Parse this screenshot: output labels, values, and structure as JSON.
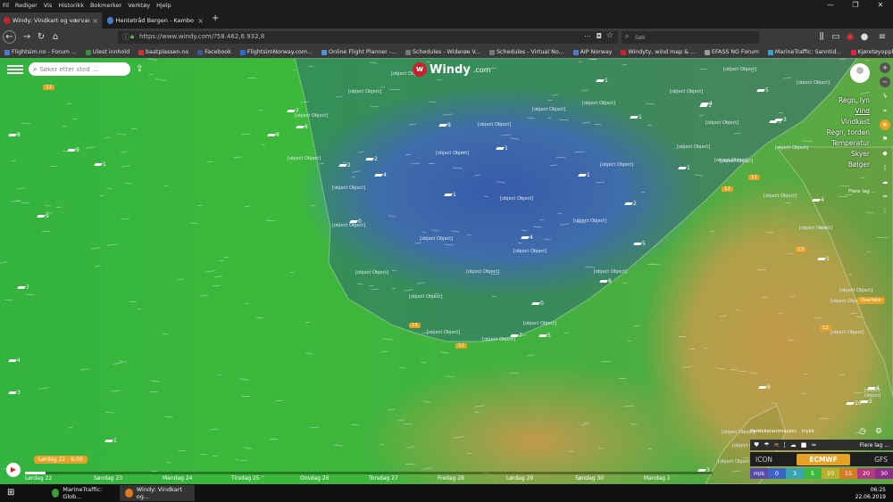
{
  "menu": [
    "Fil",
    "Rediger",
    "Vis",
    "Historikk",
    "Bokmerker",
    "Verktøy",
    "Hjelp"
  ],
  "window_controls": [
    "—",
    "❐",
    "✕"
  ],
  "tabs": [
    {
      "label": "Windy: Vindkart og værvarsel",
      "active": true
    },
    {
      "label": "Hentetråd Bergen - Kambo (Sa...",
      "active": false
    }
  ],
  "new_tab": "+",
  "url": "https://www.windy.com/?58.462,6.932,8",
  "search_placeholder": "Søk",
  "bookmarks": [
    "Flightsim.no - Forum ...",
    "Ulest innhold",
    "baatplassen.no",
    "Facebook",
    "FlightsimNorway.com...",
    "Online Flight Planner -...",
    "Schedules - Widerøe V...",
    "Schedules - Virtual No...",
    "AIP Norway",
    "Windyty, wind map & ...",
    "EFASS NG Forum",
    "MarineTraffic: Sanntid...",
    "Kjøretøyopplysninger |..."
  ],
  "map": {
    "search_placeholder": "Søker etter sted ...",
    "logo_text": "Windy",
    "logo_suffix": ".com",
    "cities": [
      {
        "name": "Sandeid"
      },
      {
        "name": "Sauda"
      },
      {
        "name": "Haugesund"
      },
      {
        "name": "Skudeneshavn"
      },
      {
        "name": "Stavanger"
      },
      {
        "name": "Bryne"
      },
      {
        "name": "Åsheram"
      },
      {
        "name": "Byglandsfjord"
      },
      {
        "name": "Egersund"
      },
      {
        "name": "Flekkefjord"
      },
      {
        "name": "Farsund"
      },
      {
        "name": "Mandal"
      },
      {
        "name": "Kristiansand"
      },
      {
        "name": "Arendal"
      },
      {
        "name": "Tonstad"
      },
      {
        "name": "Sirdal"
      },
      {
        "name": "Dalen"
      },
      {
        "name": "Seljord"
      },
      {
        "name": "Bykle"
      },
      {
        "name": "Åmli"
      },
      {
        "name": "Evje"
      },
      {
        "name": "Notodden"
      },
      {
        "name": "Kongsberg"
      },
      {
        "name": "Larvik"
      },
      {
        "name": "Strømstad"
      },
      {
        "name": "Fredrikstad"
      },
      {
        "name": "Uddevalla"
      },
      {
        "name": "Hjørring"
      },
      {
        "name": "Frederikshavn"
      },
      {
        "name": "Brønderslev"
      },
      {
        "name": "Lysekil"
      },
      {
        "name": "Ljungskile"
      },
      {
        "name": "Ålesø"
      },
      {
        "name": "Sandefjord"
      },
      {
        "name": "Hønefoss"
      },
      {
        "name": "Skien"
      },
      {
        "name": "Fyresdal"
      },
      {
        "name": "Brumunddal"
      },
      {
        "name": "Rygge"
      }
    ],
    "wind_labels": [
      {
        "v": "11",
        "tag": true
      },
      {
        "v": "7"
      },
      {
        "v": "8"
      },
      {
        "v": "9"
      },
      {
        "v": "8"
      },
      {
        "v": "8"
      },
      {
        "v": "1"
      },
      {
        "v": "9"
      },
      {
        "v": "7"
      },
      {
        "v": "4"
      },
      {
        "v": "3"
      },
      {
        "v": "1"
      },
      {
        "v": "4"
      },
      {
        "v": "0"
      },
      {
        "v": "2"
      },
      {
        "v": "1"
      },
      {
        "v": "9"
      },
      {
        "v": "1"
      },
      {
        "v": "2"
      },
      {
        "v": "1"
      },
      {
        "v": "4"
      },
      {
        "v": "1"
      },
      {
        "v": "1"
      },
      {
        "v": "1"
      },
      {
        "v": "1"
      },
      {
        "v": "5"
      },
      {
        "v": "8"
      },
      {
        "v": "0"
      },
      {
        "v": "5"
      },
      {
        "v": "7"
      },
      {
        "v": "3"
      },
      {
        "v": "2"
      },
      {
        "v": "11",
        "tag": true
      },
      {
        "v": "12",
        "tag": true
      },
      {
        "v": "11",
        "tag": true
      },
      {
        "v": "11",
        "tag": true
      },
      {
        "v": "3"
      },
      {
        "v": "13",
        "tag": true
      },
      {
        "v": "12",
        "tag": true
      },
      {
        "v": "10"
      },
      {
        "v": "9"
      },
      {
        "v": "1"
      },
      {
        "v": "4"
      },
      {
        "v": "5"
      },
      {
        "v": "4"
      },
      {
        "v": "3"
      },
      {
        "v": "4"
      },
      {
        "v": "2"
      }
    ],
    "layers": [
      "Bølger",
      "Skyer",
      "Temperatur",
      "Regn, torden",
      "Vindkast",
      "Vind",
      "Regn, lyn"
    ],
    "active_layer": "Vind",
    "more_layers": "Flere lag ...",
    "overlay_pill": "Overføke",
    "anim_label": "Partikkelanimasjon",
    "anim_option": "trykk",
    "more_layers_bottom": "Flere lag ...",
    "models": [
      "ICON",
      "ECMWF",
      "GFS"
    ],
    "selected_model": "ECMWF",
    "legend_unit": "m/s",
    "legend_values": [
      "0",
      "3",
      "5",
      "10",
      "15",
      "20",
      "30"
    ],
    "legend_colors": [
      "#5b4aa8",
      "#3c63c6",
      "#38a5b5",
      "#3ab93e",
      "#b9b02d",
      "#d57b25",
      "#b23a7d",
      "#8e2a8a"
    ],
    "time_bubble": "Lørdag 22 - 6:00",
    "play_icon": "▶",
    "days": [
      "Lørdag 22",
      "Søndag 23",
      "Mandag 24",
      "Tirsdag 25",
      "Onsdag 26",
      "Torsdag 27",
      "Fredag 28",
      "Lørdag 29",
      "Søndag 30",
      "Mandag 1"
    ],
    "progress": 0.03
  },
  "taskbar": {
    "items": [
      {
        "label": "MarineTraffic: Glob...",
        "active": false
      },
      {
        "label": "Windy: Vindkart og...",
        "active": true
      }
    ],
    "time": "06:25",
    "date": "22.06.2019"
  }
}
